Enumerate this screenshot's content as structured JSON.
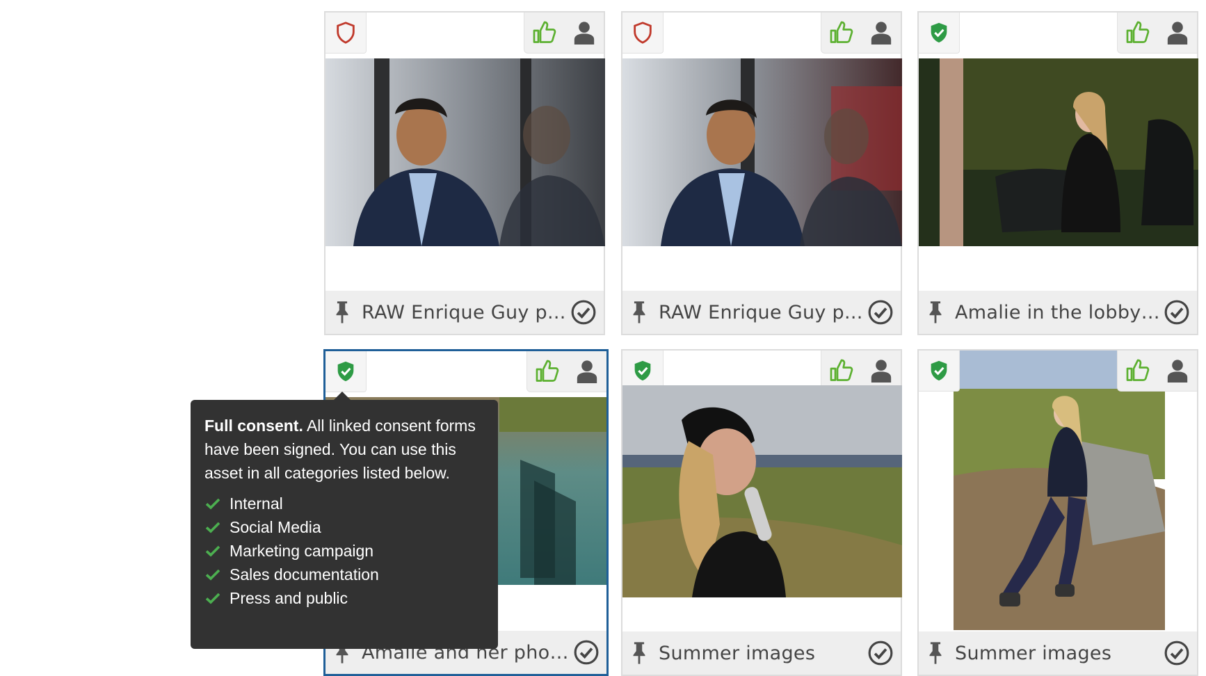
{
  "assets": [
    {
      "title": "RAW Enrique Guy p...",
      "consent": "partial",
      "selected": false
    },
    {
      "title": "RAW Enrique Guy p...",
      "consent": "partial",
      "selected": false
    },
    {
      "title": "Amalie in the lobby ...",
      "consent": "full",
      "selected": false
    },
    {
      "title": "Amalie and her phone",
      "consent": "full",
      "selected": true
    },
    {
      "title": "Summer images",
      "consent": "full",
      "selected": false
    },
    {
      "title": "Summer images",
      "consent": "full",
      "selected": false
    }
  ],
  "tooltip": {
    "heading": "Full consent.",
    "body": " All linked consent forms have been signed. You can use this asset in all categories listed below.",
    "categories": [
      "Internal",
      "Social Media",
      "Marketing campaign",
      "Sales documentation",
      "Press and public"
    ]
  },
  "colors": {
    "full_consent": "#2e9b45",
    "partial_consent": "#c0392b",
    "thumbs_up": "#5cb030",
    "selected_border": "#1f5f98",
    "tooltip_bg": "#323232"
  },
  "icons": {
    "consent_full": "shield-check-icon",
    "consent_partial": "shield-outline-icon",
    "like": "thumbs-up-icon",
    "person": "person-icon",
    "pin": "pin-icon",
    "select": "check-circle-icon"
  }
}
